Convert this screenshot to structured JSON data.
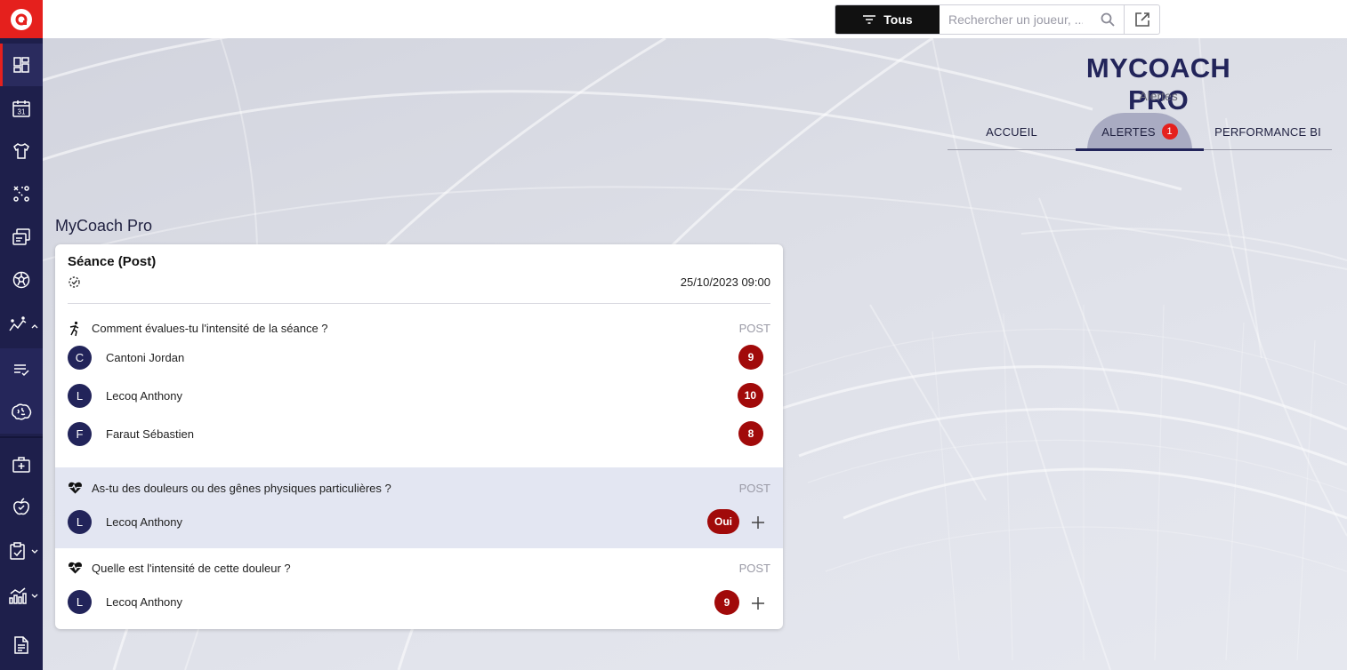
{
  "topbar": {
    "filter_label": "Tous",
    "search_placeholder": "Rechercher un joueur, ..."
  },
  "header": {
    "title": "MYCOACH PRO",
    "subtitle": "Alertes"
  },
  "tabs": [
    {
      "label": "ACCUEIL"
    },
    {
      "label": "ALERTES",
      "badge": "1"
    },
    {
      "label": "PERFORMANCE BI"
    }
  ],
  "section": {
    "title": "MyCoach Pro"
  },
  "card": {
    "title": "Séance (Post)",
    "date": "25/10/2023 09:00",
    "questions": [
      {
        "text": "Comment évalues-tu l'intensité de la séance ?",
        "tag": "POST",
        "icon": "intensity-icon",
        "responses": [
          {
            "initial": "C",
            "name": "Cantoni Jordan",
            "value": "9"
          },
          {
            "initial": "L",
            "name": "Lecoq Anthony",
            "value": "10"
          },
          {
            "initial": "F",
            "name": "Faraut Sébastien",
            "value": "8"
          }
        ]
      },
      {
        "text": "As-tu des douleurs ou des gênes physiques particulières ?",
        "tag": "POST",
        "icon": "heart-pulse-icon",
        "responses": [
          {
            "initial": "L",
            "name": "Lecoq Anthony",
            "value": "Oui"
          }
        ]
      },
      {
        "text": "Quelle est l'intensité de cette douleur ?",
        "tag": "POST",
        "icon": "heart-pulse-icon",
        "responses": [
          {
            "initial": "L",
            "name": "Lecoq Anthony",
            "value": "9"
          }
        ]
      }
    ]
  },
  "colors": {
    "sidebar": "#1e1f4b",
    "brand_red": "#e5201d",
    "title_navy": "#22245a",
    "score_red": "#a10a0a",
    "highlight_row": "#e3e6f2"
  },
  "sidebar_icons": [
    "dashboard-icon",
    "calendar-icon",
    "jersey-icon",
    "tactics-icon",
    "cards-icon",
    "football-icon",
    "performance-icon",
    "checklist-icon",
    "brain-icon",
    "medical-kit-icon",
    "nutrition-icon",
    "clipboard-check-icon",
    "analytics-icon",
    "document-icon"
  ],
  "calendar_day": "31"
}
